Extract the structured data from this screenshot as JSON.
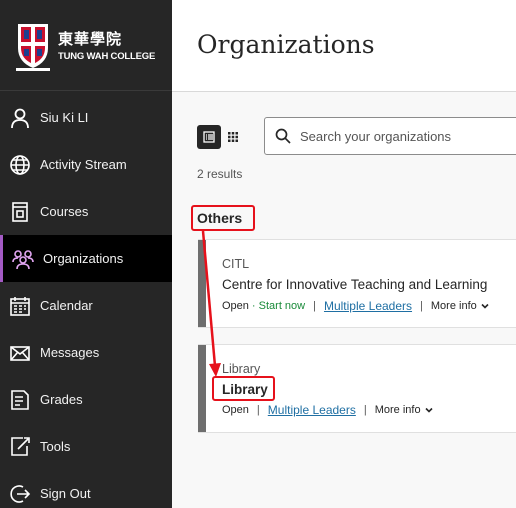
{
  "brand": {
    "name_cn": "東華學院",
    "name_en": "TUNG WAH COLLEGE"
  },
  "sidebar": {
    "items": [
      {
        "label": "Siu Ki LI",
        "icon": "person-icon"
      },
      {
        "label": "Activity Stream",
        "icon": "globe-icon"
      },
      {
        "label": "Courses",
        "icon": "courses-icon"
      },
      {
        "label": "Organizations",
        "icon": "organizations-icon",
        "active": true
      },
      {
        "label": "Calendar",
        "icon": "calendar-icon"
      },
      {
        "label": "Messages",
        "icon": "envelope-icon"
      },
      {
        "label": "Grades",
        "icon": "grades-icon"
      },
      {
        "label": "Tools",
        "icon": "tools-icon"
      },
      {
        "label": "Sign Out",
        "icon": "sign-out-icon"
      }
    ],
    "active_accent": "#a35ac4"
  },
  "main": {
    "title": "Organizations",
    "search_placeholder": "Search your organizations",
    "results": "2 results",
    "section": "Others",
    "cards": [
      {
        "id": "CITL",
        "name": "Centre for Innovative Teaching and Learning",
        "status": "Open",
        "start": "· Start now",
        "leaders": "Multiple Leaders",
        "more": "More info"
      },
      {
        "id": "Library",
        "name": "Library",
        "status": "Open",
        "leaders": "Multiple Leaders",
        "more": "More info"
      }
    ]
  },
  "colors": {
    "annotation": "#e6111b",
    "link": "#1f6fa3",
    "start_green": "#1a8b3a"
  }
}
